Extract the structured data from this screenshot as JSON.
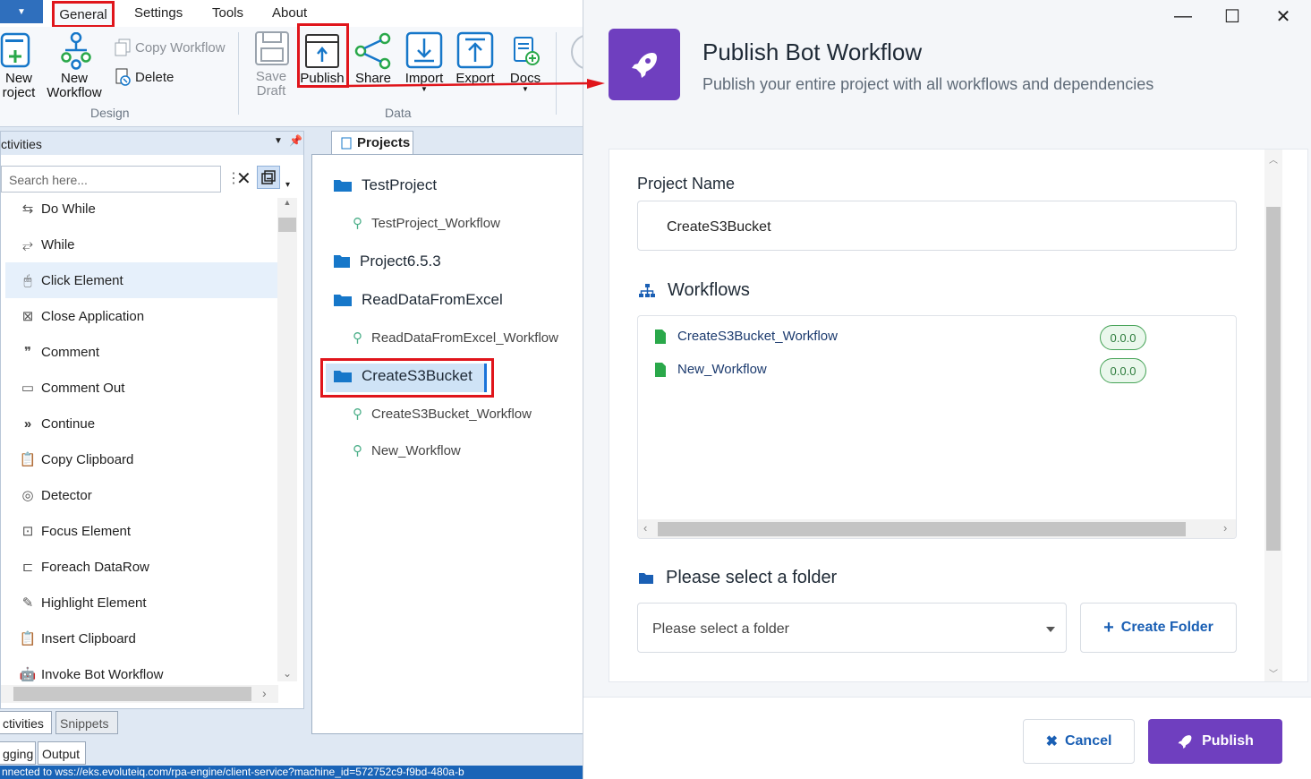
{
  "menu": {
    "items": [
      "General",
      "Settings",
      "Tools",
      "About"
    ]
  },
  "ribbon": {
    "new_project": [
      "New",
      "roject"
    ],
    "new_workflow": [
      "New",
      "Workflow"
    ],
    "copy_workflow": "Copy Workflow",
    "delete": "Delete",
    "design_group": "Design",
    "save_draft": [
      "Save",
      "Draft"
    ],
    "publish": "Publish",
    "share": "Share",
    "import": "Import",
    "export": "Export",
    "docs": "Docs",
    "data_group": "Data"
  },
  "activities": {
    "header": "ctivities",
    "search_placeholder": "Search here...",
    "items": [
      "Do While",
      "While",
      "Click Element",
      "Close Application",
      "Comment",
      "Comment Out",
      "Continue",
      "Copy Clipboard",
      "Detector",
      "Focus Element",
      "Foreach DataRow",
      "Highlight Element",
      "Insert Clipboard",
      "Invoke Bot Workflow"
    ],
    "tabs": [
      "ctivities",
      "Snippets"
    ],
    "bottom_tabs": [
      "gging",
      "Output"
    ]
  },
  "status": "nnected to wss://eks.evoluteiq.com/rpa-engine/client-service?machine_id=572752c9-f9bd-480a-b",
  "projects": {
    "tab": "Projects",
    "tree": [
      {
        "label": "TestProject",
        "type": "folder"
      },
      {
        "label": "TestProject_Workflow",
        "type": "workflow"
      },
      {
        "label": "Project6.5.3",
        "type": "folder"
      },
      {
        "label": "ReadDataFromExcel",
        "type": "folder"
      },
      {
        "label": "ReadDataFromExcel_Workflow",
        "type": "workflow"
      },
      {
        "label": "CreateS3Bucket",
        "type": "folder"
      },
      {
        "label": "CreateS3Bucket_Workflow",
        "type": "workflow"
      },
      {
        "label": "New_Workflow",
        "type": "workflow"
      }
    ]
  },
  "modal": {
    "title": "Publish Bot Workflow",
    "subtitle": "Publish your entire project with all workflows and dependencies",
    "project_name_label": "Project Name",
    "project_name_value": "CreateS3Bucket",
    "workflows_label": "Workflows",
    "workflows": [
      {
        "name": "CreateS3Bucket_Workflow",
        "version": "0.0.0"
      },
      {
        "name": "New_Workflow",
        "version": "0.0.0"
      }
    ],
    "folder_label": "Please select a folder",
    "folder_placeholder": "Please select a folder",
    "create_folder": "Create Folder",
    "cancel": "Cancel",
    "publish": "Publish"
  },
  "colors": {
    "accent": "#6f3fbf",
    "highlight_red": "#e0151b",
    "link_blue": "#1a5fb4",
    "badge_green": "#46a357"
  }
}
